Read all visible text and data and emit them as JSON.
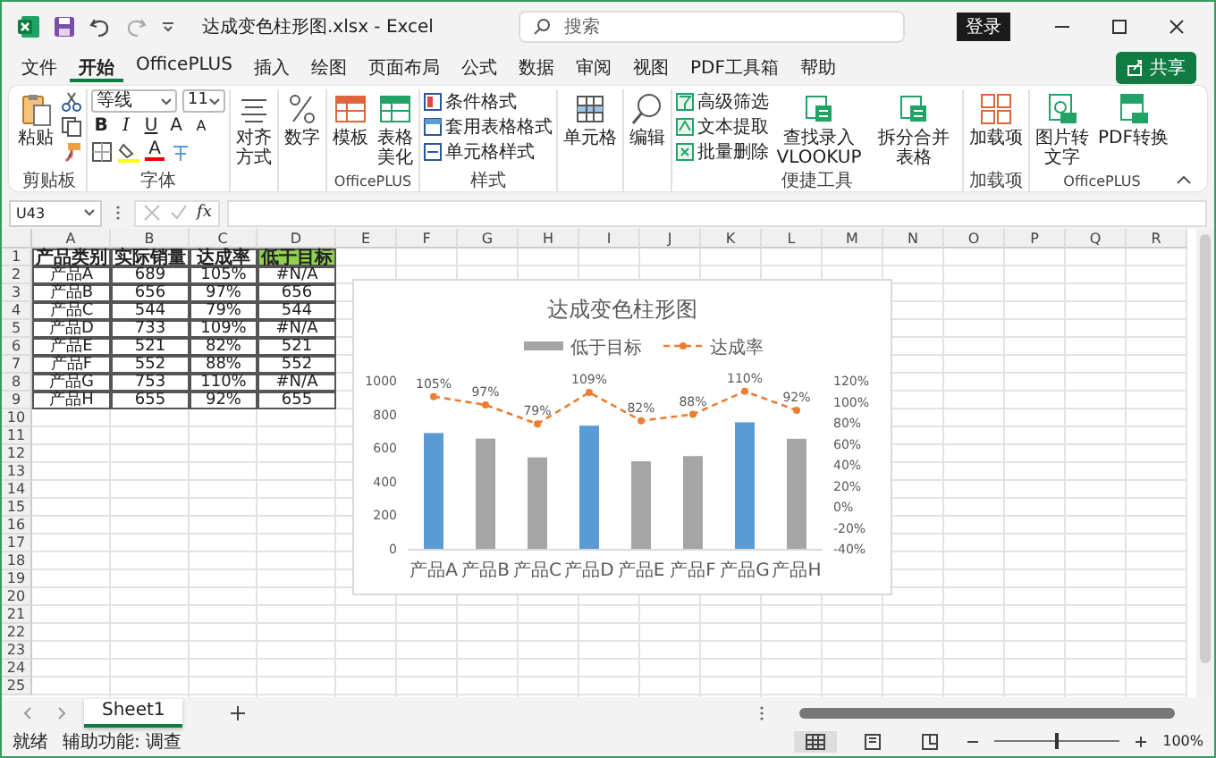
{
  "window": {
    "title": "达成变色柱形图.xlsx - Excel",
    "search_placeholder": "搜索",
    "login": "登录"
  },
  "menu_tabs": [
    {
      "label": "文件",
      "selected": false
    },
    {
      "label": "开始",
      "selected": true
    },
    {
      "label": "OfficePLUS",
      "selected": false
    },
    {
      "label": "插入",
      "selected": false
    },
    {
      "label": "绘图",
      "selected": false
    },
    {
      "label": "页面布局",
      "selected": false
    },
    {
      "label": "公式",
      "selected": false
    },
    {
      "label": "数据",
      "selected": false
    },
    {
      "label": "审阅",
      "selected": false
    },
    {
      "label": "视图",
      "selected": false
    },
    {
      "label": "PDF工具箱",
      "selected": false
    },
    {
      "label": "帮助",
      "selected": false
    }
  ],
  "share": "共享",
  "ribbon": {
    "clipboard": {
      "paste": "粘贴",
      "label": "剪贴板"
    },
    "font": {
      "name": "等线",
      "size": "11",
      "bold": "B",
      "italic": "I",
      "underline": "U",
      "grow": "A",
      "shrink": "A",
      "color_letter": "A",
      "label": "字体"
    },
    "alignment": "对齐方式",
    "number": "数字",
    "officeplus": {
      "items": [
        "模板",
        "表格美化"
      ],
      "label": "OfficePLUS"
    },
    "styles": {
      "items": [
        "条件格式",
        "套用表格格式",
        "单元格样式"
      ],
      "label": "样式"
    },
    "cells": "单元格",
    "editing": "编辑",
    "tools": {
      "small": [
        "高级筛选",
        "文本提取",
        "批量删除"
      ],
      "large": [
        "查找录入\nVLOOKUP",
        "拆分合并表格"
      ],
      "label": "便捷工具"
    },
    "addins": {
      "button": "加载项",
      "label": "加载项"
    },
    "officeplus2": {
      "items": [
        "图片转文字",
        "PDF转换"
      ],
      "label": "OfficePLUS"
    }
  },
  "formula_bar": {
    "name_box": "U43",
    "fx": "fx"
  },
  "sheet": {
    "columns": [
      "A",
      "B",
      "C",
      "D",
      "E",
      "F",
      "G",
      "H",
      "I",
      "J",
      "K",
      "L",
      "M",
      "N",
      "O",
      "P",
      "Q",
      "R"
    ],
    "row_numbers": [
      "1",
      "2",
      "3",
      "4",
      "5",
      "6",
      "7",
      "8",
      "9",
      "10",
      "11",
      "12",
      "13",
      "14",
      "15",
      "16",
      "17",
      "18",
      "19",
      "20",
      "21",
      "22",
      "23",
      "24",
      "25"
    ],
    "table": {
      "header": [
        {
          "text": "产品类别",
          "highlighted": false
        },
        {
          "text": "实际销量",
          "highlighted": false
        },
        {
          "text": "达成率",
          "highlighted": false
        },
        {
          "text": "低于目标",
          "highlighted": true
        }
      ],
      "rows": [
        [
          "产品A",
          "689",
          "105%",
          "#N/A"
        ],
        [
          "产品B",
          "656",
          "97%",
          "656"
        ],
        [
          "产品C",
          "544",
          "79%",
          "544"
        ],
        [
          "产品D",
          "733",
          "109%",
          "#N/A"
        ],
        [
          "产品E",
          "521",
          "82%",
          "521"
        ],
        [
          "产品F",
          "552",
          "88%",
          "552"
        ],
        [
          "产品G",
          "753",
          "110%",
          "#N/A"
        ],
        [
          "产品H",
          "655",
          "92%",
          "655"
        ]
      ]
    },
    "chart": {
      "chart_data": {
        "type": "bar",
        "title": "达成变色柱形图",
        "categories": [
          "产品A",
          "产品B",
          "产品C",
          "产品D",
          "产品E",
          "产品F",
          "产品G",
          "产品H"
        ],
        "stacked": true,
        "legend": true,
        "series": [
          {
            "color": "#5b9bd5",
            "values": [
              689,
              null,
              null,
              733,
              null,
              null,
              753,
              null
            ]
          },
          {
            "name": "低于目标",
            "color": "#a5a5a5",
            "values": [
              null,
              656,
              544,
              null,
              521,
              552,
              null,
              655
            ]
          },
          {
            "name": "达成率",
            "color": "#ed7d31",
            "type": "line",
            "axis": "y2",
            "line_style": "dashed",
            "marker": "circle",
            "values": [
              105,
              97,
              79,
              109,
              82,
              88,
              110,
              92
            ],
            "value_labels": [
              "105%",
              "97%",
              "79%",
              "109%",
              "82%",
              "88%",
              "110%",
              "92%"
            ]
          }
        ],
        "ylim": [
          0,
          1000
        ],
        "yticks": [
          0,
          200,
          400,
          600,
          800,
          1000
        ],
        "y2lim": [
          -40,
          120
        ],
        "y2ticks": [
          {
            "value": -40,
            "label": "-40%"
          },
          {
            "value": -20,
            "label": "-20%"
          },
          {
            "value": 0,
            "label": "0%"
          },
          {
            "value": 20,
            "label": "20%"
          },
          {
            "value": 40,
            "label": "40%"
          },
          {
            "value": 60,
            "label": "60%"
          },
          {
            "value": 80,
            "label": "80%"
          },
          {
            "value": 100,
            "label": "100%"
          },
          {
            "value": 120,
            "label": "120%"
          }
        ]
      }
    }
  },
  "sheet_tabs": [
    {
      "label": "Sheet1",
      "selected": true
    }
  ],
  "status": {
    "ready": "就绪",
    "accessibility": "辅助功能: 调查",
    "zoom": "100%",
    "zoom_slider": {
      "level": 0.5
    }
  }
}
